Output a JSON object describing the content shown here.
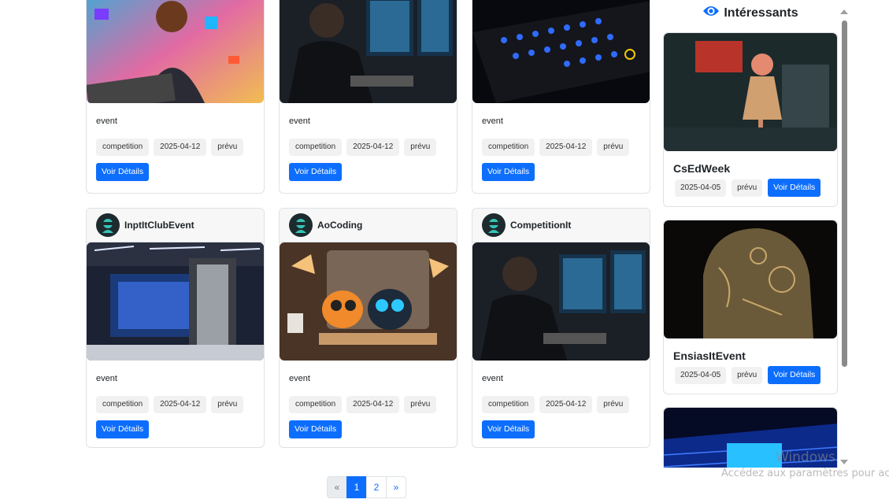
{
  "grid": {
    "button_label": "Voir Détails",
    "cards_top": [
      {
        "type": "event",
        "badges": [
          "competition",
          "2025-04-12",
          "prévu"
        ]
      },
      {
        "type": "event",
        "badges": [
          "competition",
          "2025-04-12",
          "prévu"
        ]
      },
      {
        "type": "event",
        "badges": [
          "competition",
          "2025-04-12",
          "prévu"
        ]
      }
    ],
    "cards_bottom": [
      {
        "author": "InptItClubEvent",
        "type": "event",
        "badges": [
          "competition",
          "2025-04-12",
          "prévu"
        ]
      },
      {
        "author": "AoCoding",
        "type": "event",
        "badges": [
          "competition",
          "2025-04-12",
          "prévu"
        ]
      },
      {
        "author": "CompetitionIt",
        "type": "event",
        "badges": [
          "competition",
          "2025-04-12",
          "prévu"
        ]
      }
    ]
  },
  "sidebar": {
    "title": "Intéressants",
    "icon": "eye-icon",
    "items": [
      {
        "name": "CsEdWeek",
        "date": "2025-04-05",
        "status": "prévu",
        "button": "Voir Détails"
      },
      {
        "name": "EnsiasItEvent",
        "date": "2025-04-05",
        "status": "prévu",
        "button": "Voir Détails"
      }
    ]
  },
  "pagination": {
    "prev": "«",
    "pages": [
      "1",
      "2"
    ],
    "next": "»",
    "active": "1"
  },
  "watermark": {
    "line1": "Windows",
    "line2": "Accédez aux paramètres pour ac"
  },
  "colors": {
    "primary": "#0d6efd",
    "card_border": "#dee2e6"
  }
}
